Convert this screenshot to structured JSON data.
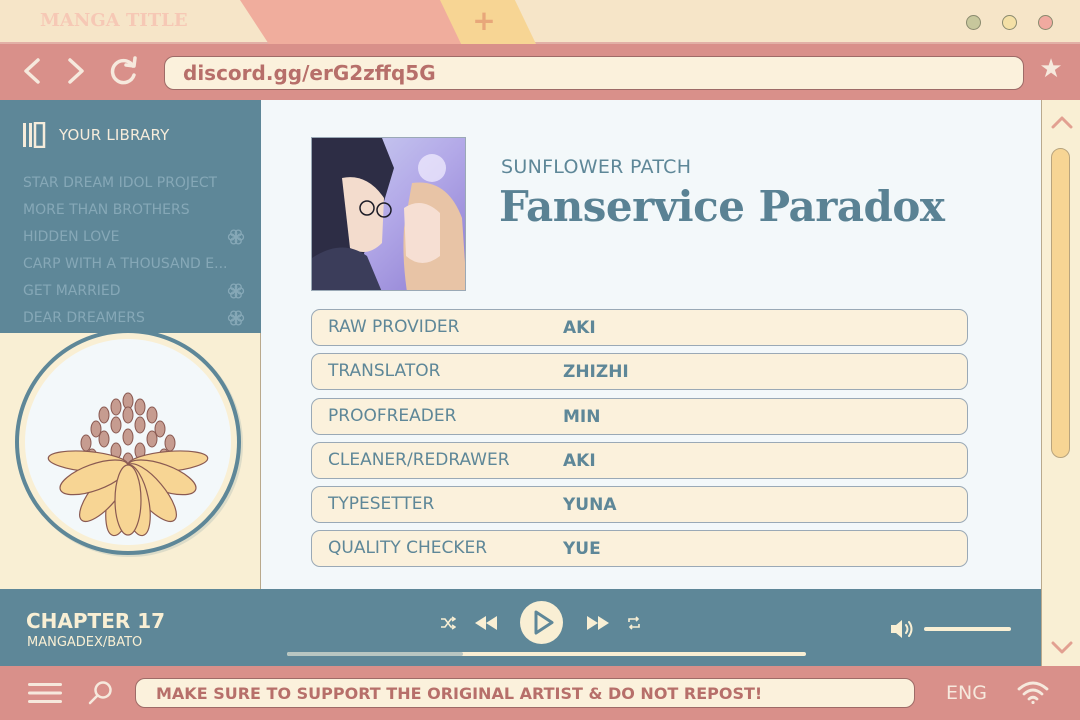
{
  "browser": {
    "tab_label": "MANGA TITLE",
    "new_tab_symbol": "+",
    "address": "discord.gg/erG2zffq5G",
    "window_dots": [
      "#c7c79c",
      "#f4e0a6",
      "#f0aaa0"
    ]
  },
  "sidebar": {
    "title": "YOUR LIBRARY",
    "items": [
      {
        "label": "STAR DREAM IDOL PROJECT",
        "badge": false
      },
      {
        "label": "MORE THAN BROTHERS",
        "badge": false
      },
      {
        "label": "HIDDEN LOVE",
        "badge": true
      },
      {
        "label": "CARP WITH A THOUSAND E...",
        "badge": false
      },
      {
        "label": "GET MARRIED",
        "badge": true
      },
      {
        "label": "DEAR DREAMERS",
        "badge": true
      }
    ]
  },
  "series": {
    "group": "SUNFLOWER PATCH",
    "title": "Fanservice Paradox"
  },
  "credits": [
    {
      "role": "RAW PROVIDER",
      "name": "AKI"
    },
    {
      "role": "TRANSLATOR",
      "name": "ZHIZHI"
    },
    {
      "role": "PROOFREADER",
      "name": "MIN"
    },
    {
      "role": "CLEANER/REDRAWER",
      "name": "AKI"
    },
    {
      "role": "TYPESETTER",
      "name": "YUNA"
    },
    {
      "role": "QUALITY CHECKER",
      "name": "YUE"
    }
  ],
  "player": {
    "chapter": "CHAPTER 17",
    "source": "MANGADEX/BATO",
    "progress": 0.34,
    "volume": 1.0
  },
  "status": {
    "notice": "MAKE SURE TO SUPPORT THE ORIGINAL ARTIST & DO NOT REPOST!",
    "language": "ENG"
  },
  "colors": {
    "teal": "#5e8798",
    "cream": "#f9efd4",
    "rose": "#d9908a",
    "sunflower": "#f7d594"
  }
}
